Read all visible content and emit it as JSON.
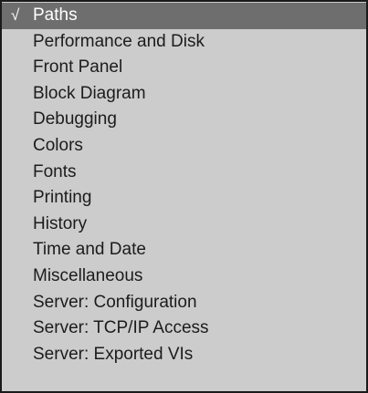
{
  "menu": {
    "selected_index": 0,
    "check_glyph": "√",
    "items": [
      {
        "label": "Paths"
      },
      {
        "label": "Performance and Disk"
      },
      {
        "label": "Front Panel"
      },
      {
        "label": "Block Diagram"
      },
      {
        "label": "Debugging"
      },
      {
        "label": "Colors"
      },
      {
        "label": "Fonts"
      },
      {
        "label": "Printing"
      },
      {
        "label": "History"
      },
      {
        "label": "Time and Date"
      },
      {
        "label": "Miscellaneous"
      },
      {
        "label": "Server: Configuration"
      },
      {
        "label": "Server: TCP/IP Access"
      },
      {
        "label": "Server: Exported VIs"
      }
    ],
    "colors": {
      "background": "#cccccc",
      "selected_background": "#6e6e6e",
      "selected_text": "#ffffff",
      "text": "#1c1c1c",
      "border": "#1a1a1a"
    }
  }
}
